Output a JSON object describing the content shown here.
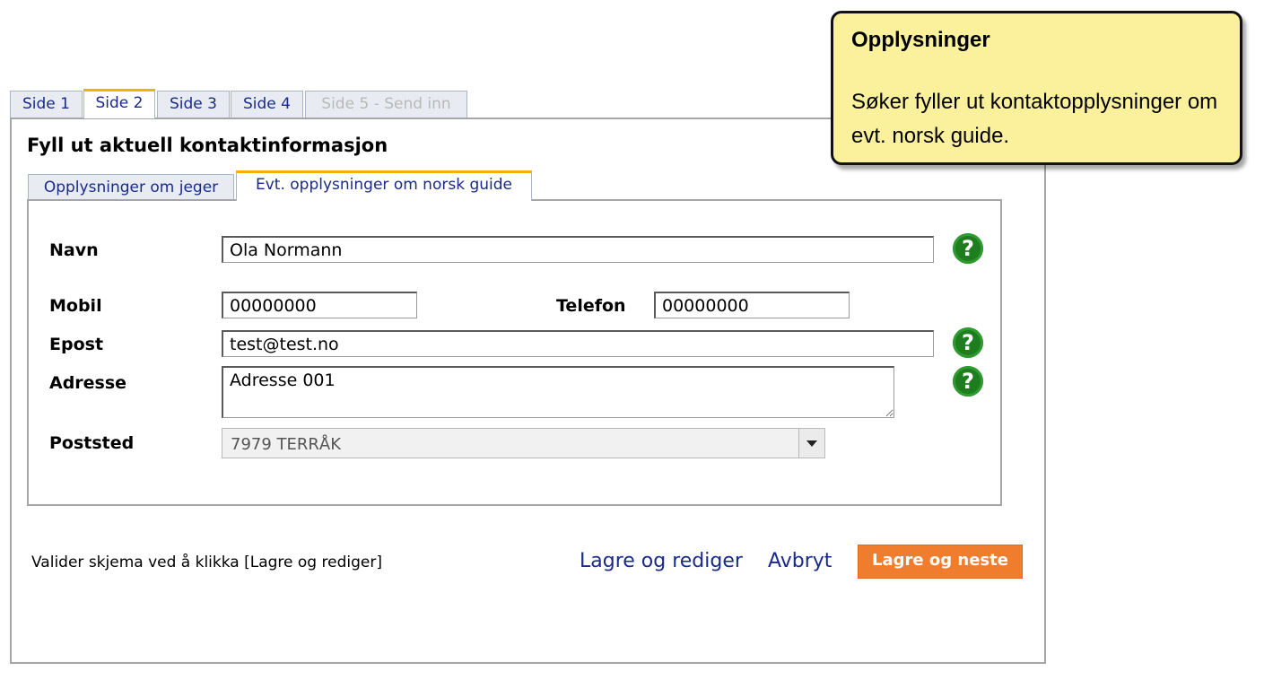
{
  "tabs": [
    {
      "label": "Side 1",
      "state": "normal"
    },
    {
      "label": "Side 2",
      "state": "active"
    },
    {
      "label": "Side 3",
      "state": "normal"
    },
    {
      "label": "Side 4",
      "state": "normal"
    },
    {
      "label": "Side 5 - Send inn",
      "state": "disabled"
    }
  ],
  "heading": "Fyll ut aktuell kontaktinformasjon",
  "subtabs": [
    {
      "label": "Opplysninger om jeger",
      "state": "normal"
    },
    {
      "label": "Evt. opplysninger om norsk guide",
      "state": "active"
    }
  ],
  "form": {
    "navn": {
      "label": "Navn",
      "value": "Ola Normann"
    },
    "mobil": {
      "label": "Mobil",
      "value": "00000000"
    },
    "telefon": {
      "label": "Telefon",
      "value": "00000000"
    },
    "epost": {
      "label": "Epost",
      "value": "test@test.no"
    },
    "adresse": {
      "label": "Adresse",
      "value": "Adresse 001"
    },
    "poststed": {
      "label": "Poststed",
      "value": "7979 TERRÅK"
    },
    "help_icon": "?"
  },
  "footer": {
    "note": "Valider skjema ved å klikka [Lagre og rediger]",
    "save_edit": "Lagre og rediger",
    "cancel": "Avbryt",
    "save_next": "Lagre og neste"
  },
  "callout": {
    "title": "Opplysninger",
    "text": "Søker fyller ut kontaktopplysninger om evt. norsk guide."
  },
  "colors": {
    "accent": "#f07d2e",
    "link": "#1a2a8a",
    "help": "#1e7d1e",
    "callout_bg": "#fbf19c",
    "tab_active": "#f0b400"
  }
}
